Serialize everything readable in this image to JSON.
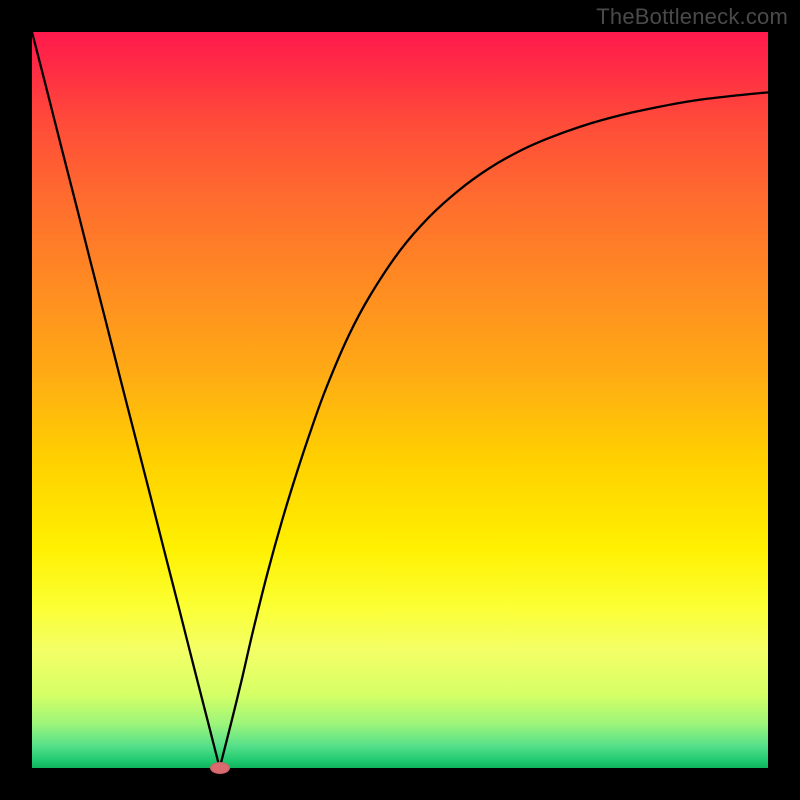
{
  "watermark": "TheBottleneck.com",
  "chart_data": {
    "type": "line",
    "title": "",
    "xlabel": "",
    "ylabel": "",
    "xlim": [
      0,
      100
    ],
    "ylim": [
      0,
      100
    ],
    "grid": false,
    "legend": false,
    "series": [
      {
        "name": "curve",
        "color": "#000000",
        "stroke_width": 2.3,
        "x": [
          0,
          2,
          4,
          6,
          8,
          10,
          12,
          14,
          16,
          18,
          20,
          22,
          24,
          25.5,
          27,
          28.5,
          30,
          32,
          34,
          36,
          38,
          40,
          43,
          46,
          50,
          54,
          58,
          62,
          66,
          70,
          75,
          80,
          85,
          90,
          95,
          100
        ],
        "values": [
          100,
          92.2,
          84.3,
          76.5,
          68.6,
          60.8,
          52.9,
          45.1,
          37.3,
          29.4,
          21.6,
          13.7,
          5.9,
          0,
          5.9,
          12.0,
          18.5,
          26.5,
          33.7,
          40.2,
          46.2,
          51.7,
          58.7,
          64.3,
          70.3,
          74.9,
          78.5,
          81.4,
          83.7,
          85.5,
          87.3,
          88.7,
          89.8,
          90.7,
          91.3,
          91.8
        ]
      }
    ],
    "marker": {
      "x": 25.5,
      "y": 0,
      "color": "#d96a6f",
      "shape": "ellipse"
    }
  },
  "plot": {
    "bg_gradient_top": "#ff1a4d",
    "bg_gradient_bottom": "#0db35a",
    "frame_border_color": "#000000"
  }
}
